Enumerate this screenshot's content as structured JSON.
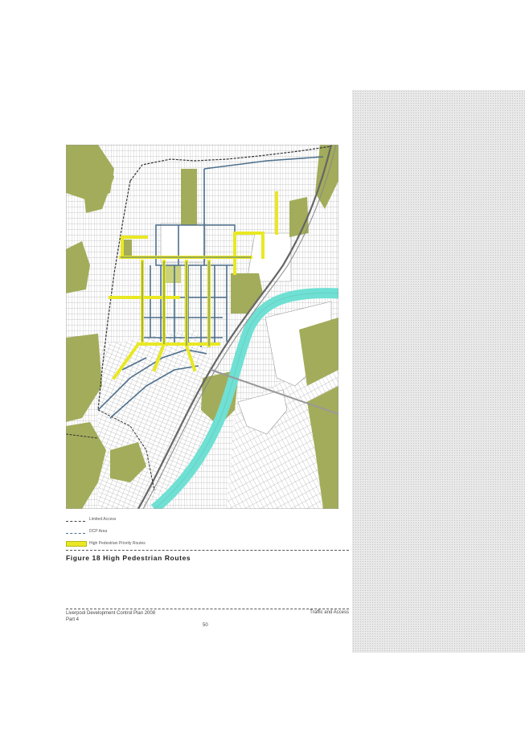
{
  "figure": {
    "caption": "Figure 18  High Pedestrian Routes",
    "map_icon": "site-map-graphic"
  },
  "legend": {
    "items": [
      {
        "label": "Limited Access",
        "symbol": "black-dashed-line"
      },
      {
        "label": "DCP Area",
        "symbol": "blue-dashed-line"
      },
      {
        "label": "High Pedestrian Priority Routes",
        "symbol": "yellow-band"
      }
    ]
  },
  "footer": {
    "left_line1": "Liverpool Development Control Plan 2008",
    "left_line2": "Part 4",
    "right": "Traffic and Access",
    "page_number": "50"
  },
  "colors": {
    "river": "#6fe0d3",
    "parkland": "#a3ac5a",
    "pedestrian_route": "#e9e823",
    "dcp_boundary": "#4d6f8c",
    "sidebar": "#e6e6e6"
  }
}
